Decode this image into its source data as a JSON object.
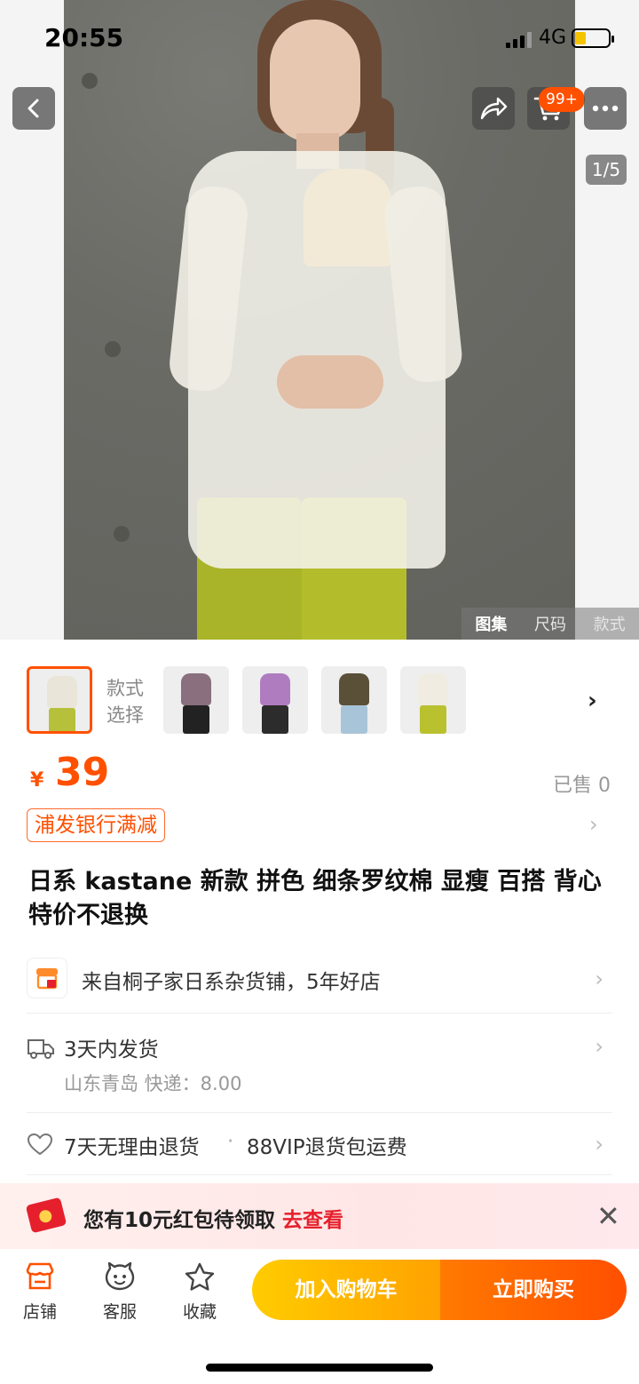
{
  "status_bar": {
    "time": "20:55",
    "network": "4G"
  },
  "hero": {
    "cart_badge": "99+",
    "image_counter": "1/5",
    "tabs": [
      "图集",
      "尺码",
      "款式"
    ]
  },
  "thumbnails": {
    "label": "款式选择",
    "colors": [
      {
        "top": "#e9e5d8",
        "bottom": "#b7c03a"
      },
      {
        "top": "#8a6f7e",
        "bottom": "#222222"
      },
      {
        "top": "#b07cc0",
        "bottom": "#2c2c2c"
      },
      {
        "top": "#5a5038",
        "bottom": "#a8c4d8"
      },
      {
        "top": "#f0ece2",
        "bottom": "#b9c22e"
      }
    ]
  },
  "price": {
    "symbol": "¥",
    "value": "39",
    "sold": "已售 0"
  },
  "promo": {
    "label": "浦发银行满减"
  },
  "product": {
    "title": "日系 kastane 新款 拼色 细条罗纹棉 显瘦 百搭 背心 特价不退换"
  },
  "shop": {
    "text": "来自桐子家日系杂货铺，5年好店"
  },
  "shipping": {
    "title": "3天内发货",
    "detail": "山东青岛  快递：8.00"
  },
  "returns": {
    "text": "7天无理由退货",
    "extra": "88VIP退货包运费"
  },
  "banner": {
    "message": "您有10元红包待领取",
    "link": "去查看"
  },
  "bottom_bar": {
    "shop": "店铺",
    "service": "客服",
    "favorite": "收藏",
    "add_to_cart": "加入购物车",
    "buy_now": "立即购买"
  },
  "colors": {
    "accent": "#ff5000",
    "cart_gradient": "#ffb000",
    "buy_gradient": "#ff5a00"
  }
}
